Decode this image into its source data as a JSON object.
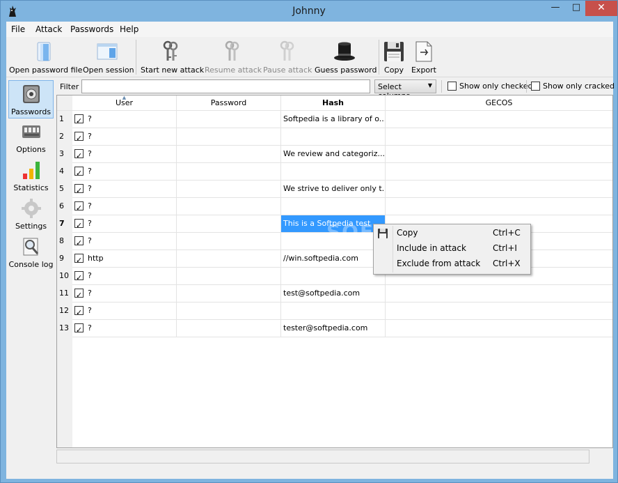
{
  "window": {
    "title": "Johnny"
  },
  "menu": [
    "File",
    "Attack",
    "Passwords",
    "Help"
  ],
  "toolbar": {
    "open_password_file": "Open password file",
    "open_session": "Open session",
    "start_new_attack": "Start new attack",
    "resume_attack": "Resume attack",
    "pause_attack": "Pause attack",
    "guess_password": "Guess password",
    "copy": "Copy",
    "export": "Export"
  },
  "sidebar": [
    "Passwords",
    "Options",
    "Statistics",
    "Settings",
    "Console log"
  ],
  "filterbar": {
    "filter_label": "Filter",
    "filter_value": "",
    "select_columns": "Select columns",
    "show_only_checked": "Show only checked",
    "show_only_cracked": "Show only cracked"
  },
  "table": {
    "columns": [
      "User",
      "Password",
      "Hash",
      "GECOS"
    ],
    "rows": [
      {
        "num": "1",
        "user": "?",
        "password": "",
        "hash": "Softpedia is a library of o...",
        "gecos": ""
      },
      {
        "num": "2",
        "user": "?",
        "password": "",
        "hash": "",
        "gecos": ""
      },
      {
        "num": "3",
        "user": "?",
        "password": "",
        "hash": "We review and categoriz...",
        "gecos": ""
      },
      {
        "num": "4",
        "user": "?",
        "password": "",
        "hash": "",
        "gecos": ""
      },
      {
        "num": "5",
        "user": "?",
        "password": "",
        "hash": "We strive to deliver only t...",
        "gecos": ""
      },
      {
        "num": "6",
        "user": "?",
        "password": "",
        "hash": "",
        "gecos": ""
      },
      {
        "num": "7",
        "user": "?",
        "password": "",
        "hash": "This is a Softpedia test",
        "gecos": ""
      },
      {
        "num": "8",
        "user": "?",
        "password": "",
        "hash": "",
        "gecos": ""
      },
      {
        "num": "9",
        "user": "http",
        "password": "",
        "hash": "//win.softpedia.com",
        "gecos": ""
      },
      {
        "num": "10",
        "user": "?",
        "password": "",
        "hash": "",
        "gecos": ""
      },
      {
        "num": "11",
        "user": "?",
        "password": "",
        "hash": "test@softpedia.com",
        "gecos": ""
      },
      {
        "num": "12",
        "user": "?",
        "password": "",
        "hash": "",
        "gecos": ""
      },
      {
        "num": "13",
        "user": "?",
        "password": "",
        "hash": "tester@softpedia.com",
        "gecos": ""
      }
    ]
  },
  "context_menu": [
    {
      "label": "Copy",
      "shortcut": "Ctrl+C"
    },
    {
      "label": "Include in attack",
      "shortcut": "Ctrl+I"
    },
    {
      "label": "Exclude from attack",
      "shortcut": "Ctrl+X"
    }
  ],
  "watermark": "SOFTPEDIA"
}
